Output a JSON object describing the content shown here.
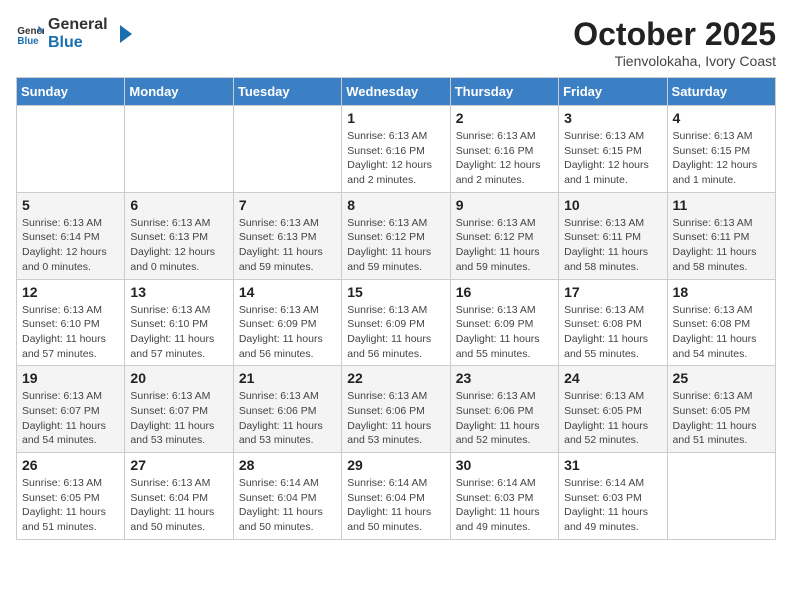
{
  "logo": {
    "general": "General",
    "blue": "Blue"
  },
  "title": "October 2025",
  "location": "Tienvolokaha, Ivory Coast",
  "days_of_week": [
    "Sunday",
    "Monday",
    "Tuesday",
    "Wednesday",
    "Thursday",
    "Friday",
    "Saturday"
  ],
  "weeks": [
    [
      {
        "day": "",
        "info": ""
      },
      {
        "day": "",
        "info": ""
      },
      {
        "day": "",
        "info": ""
      },
      {
        "day": "1",
        "info": "Sunrise: 6:13 AM\nSunset: 6:16 PM\nDaylight: 12 hours\nand 2 minutes."
      },
      {
        "day": "2",
        "info": "Sunrise: 6:13 AM\nSunset: 6:16 PM\nDaylight: 12 hours\nand 2 minutes."
      },
      {
        "day": "3",
        "info": "Sunrise: 6:13 AM\nSunset: 6:15 PM\nDaylight: 12 hours\nand 1 minute."
      },
      {
        "day": "4",
        "info": "Sunrise: 6:13 AM\nSunset: 6:15 PM\nDaylight: 12 hours\nand 1 minute."
      }
    ],
    [
      {
        "day": "5",
        "info": "Sunrise: 6:13 AM\nSunset: 6:14 PM\nDaylight: 12 hours\nand 0 minutes."
      },
      {
        "day": "6",
        "info": "Sunrise: 6:13 AM\nSunset: 6:13 PM\nDaylight: 12 hours\nand 0 minutes."
      },
      {
        "day": "7",
        "info": "Sunrise: 6:13 AM\nSunset: 6:13 PM\nDaylight: 11 hours\nand 59 minutes."
      },
      {
        "day": "8",
        "info": "Sunrise: 6:13 AM\nSunset: 6:12 PM\nDaylight: 11 hours\nand 59 minutes."
      },
      {
        "day": "9",
        "info": "Sunrise: 6:13 AM\nSunset: 6:12 PM\nDaylight: 11 hours\nand 59 minutes."
      },
      {
        "day": "10",
        "info": "Sunrise: 6:13 AM\nSunset: 6:11 PM\nDaylight: 11 hours\nand 58 minutes."
      },
      {
        "day": "11",
        "info": "Sunrise: 6:13 AM\nSunset: 6:11 PM\nDaylight: 11 hours\nand 58 minutes."
      }
    ],
    [
      {
        "day": "12",
        "info": "Sunrise: 6:13 AM\nSunset: 6:10 PM\nDaylight: 11 hours\nand 57 minutes."
      },
      {
        "day": "13",
        "info": "Sunrise: 6:13 AM\nSunset: 6:10 PM\nDaylight: 11 hours\nand 57 minutes."
      },
      {
        "day": "14",
        "info": "Sunrise: 6:13 AM\nSunset: 6:09 PM\nDaylight: 11 hours\nand 56 minutes."
      },
      {
        "day": "15",
        "info": "Sunrise: 6:13 AM\nSunset: 6:09 PM\nDaylight: 11 hours\nand 56 minutes."
      },
      {
        "day": "16",
        "info": "Sunrise: 6:13 AM\nSunset: 6:09 PM\nDaylight: 11 hours\nand 55 minutes."
      },
      {
        "day": "17",
        "info": "Sunrise: 6:13 AM\nSunset: 6:08 PM\nDaylight: 11 hours\nand 55 minutes."
      },
      {
        "day": "18",
        "info": "Sunrise: 6:13 AM\nSunset: 6:08 PM\nDaylight: 11 hours\nand 54 minutes."
      }
    ],
    [
      {
        "day": "19",
        "info": "Sunrise: 6:13 AM\nSunset: 6:07 PM\nDaylight: 11 hours\nand 54 minutes."
      },
      {
        "day": "20",
        "info": "Sunrise: 6:13 AM\nSunset: 6:07 PM\nDaylight: 11 hours\nand 53 minutes."
      },
      {
        "day": "21",
        "info": "Sunrise: 6:13 AM\nSunset: 6:06 PM\nDaylight: 11 hours\nand 53 minutes."
      },
      {
        "day": "22",
        "info": "Sunrise: 6:13 AM\nSunset: 6:06 PM\nDaylight: 11 hours\nand 53 minutes."
      },
      {
        "day": "23",
        "info": "Sunrise: 6:13 AM\nSunset: 6:06 PM\nDaylight: 11 hours\nand 52 minutes."
      },
      {
        "day": "24",
        "info": "Sunrise: 6:13 AM\nSunset: 6:05 PM\nDaylight: 11 hours\nand 52 minutes."
      },
      {
        "day": "25",
        "info": "Sunrise: 6:13 AM\nSunset: 6:05 PM\nDaylight: 11 hours\nand 51 minutes."
      }
    ],
    [
      {
        "day": "26",
        "info": "Sunrise: 6:13 AM\nSunset: 6:05 PM\nDaylight: 11 hours\nand 51 minutes."
      },
      {
        "day": "27",
        "info": "Sunrise: 6:13 AM\nSunset: 6:04 PM\nDaylight: 11 hours\nand 50 minutes."
      },
      {
        "day": "28",
        "info": "Sunrise: 6:14 AM\nSunset: 6:04 PM\nDaylight: 11 hours\nand 50 minutes."
      },
      {
        "day": "29",
        "info": "Sunrise: 6:14 AM\nSunset: 6:04 PM\nDaylight: 11 hours\nand 50 minutes."
      },
      {
        "day": "30",
        "info": "Sunrise: 6:14 AM\nSunset: 6:03 PM\nDaylight: 11 hours\nand 49 minutes."
      },
      {
        "day": "31",
        "info": "Sunrise: 6:14 AM\nSunset: 6:03 PM\nDaylight: 11 hours\nand 49 minutes."
      },
      {
        "day": "",
        "info": ""
      }
    ]
  ]
}
